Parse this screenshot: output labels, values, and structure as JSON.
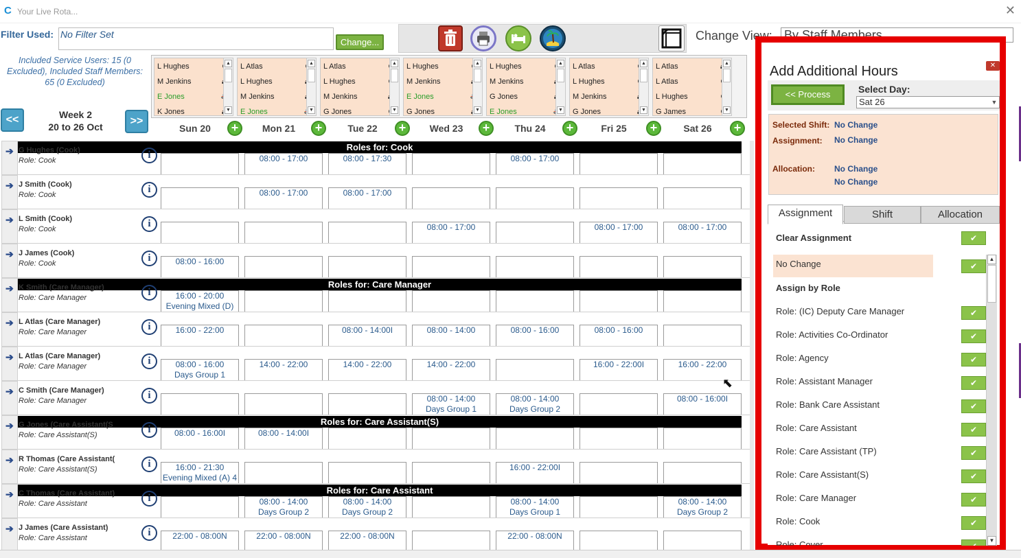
{
  "window": {
    "title": "Your Live Rota..."
  },
  "filter": {
    "label": "Filter Used:",
    "value": "No Filter Set",
    "change_label": "Change..."
  },
  "toolbar": {
    "icons": [
      "delete-icon",
      "print-icon",
      "bed-icon",
      "beach-icon",
      "expand-icon"
    ],
    "colors": {
      "delete": "#c0392b",
      "print": "#7b76c7",
      "bed": "#8bc34a",
      "beach": "#1b4f72"
    }
  },
  "change_view": {
    "label": "Change View:",
    "value": "By Staff Members"
  },
  "included": {
    "text": "Included Service Users: 15 (0 Excluded), Included Staff Members: 65 (0 Excluded)"
  },
  "week": {
    "prev": "<<",
    "next": ">>",
    "title": "Week 2",
    "range": "20 to 26 Oct"
  },
  "service_users": [
    {
      "rows": [
        {
          "name": "L Hughes",
          "icon": "no-entry-icon"
        },
        {
          "name": "M Jenkins",
          "icon": "home-out-icon"
        },
        {
          "name": "E Jones",
          "green": true,
          "icon": "ambulance-icon"
        },
        {
          "name": "K Jones",
          "icon": "home-out-icon"
        }
      ]
    },
    {
      "rows": [
        {
          "name": "L Atlas",
          "icon": "no-entry-icon"
        },
        {
          "name": "L Hughes",
          "icon": "home-out-icon"
        },
        {
          "name": "M Jenkins",
          "icon": "home-out-icon"
        },
        {
          "name": "E Jones",
          "green": true,
          "icon": "ambulance-icon"
        }
      ]
    },
    {
      "rows": [
        {
          "name": "L Atlas",
          "icon": "no-entry-icon"
        },
        {
          "name": "L Hughes",
          "icon": "no-entry-icon"
        },
        {
          "name": "M Jenkins",
          "icon": "home-out-icon"
        },
        {
          "name": "G Jones",
          "icon": "no-entry-icon"
        }
      ]
    },
    {
      "rows": [
        {
          "name": "L Hughes",
          "icon": "no-entry-icon"
        },
        {
          "name": "M Jenkins",
          "icon": "home-out-icon"
        },
        {
          "name": "E Jones",
          "green": true,
          "icon": "ambulance-icon"
        },
        {
          "name": "G Jones",
          "icon": "home-out-icon"
        }
      ]
    },
    {
      "rows": [
        {
          "name": "L Hughes",
          "icon": "no-entry-icon"
        },
        {
          "name": "M Jenkins",
          "icon": "home-out-icon"
        },
        {
          "name": "G Jones",
          "icon": "home-out-icon"
        },
        {
          "name": "E Jones",
          "green": true,
          "icon": "ambulance-icon"
        }
      ]
    },
    {
      "rows": [
        {
          "name": "L Atlas",
          "icon": "no-entry-icon"
        },
        {
          "name": "L Hughes",
          "icon": "no-entry-icon"
        },
        {
          "name": "M Jenkins",
          "icon": "home-out-icon"
        },
        {
          "name": "G Jones",
          "icon": "home-out-icon"
        }
      ]
    },
    {
      "rows": [
        {
          "name": "L Atlas",
          "icon": "home-out-icon"
        },
        {
          "name": "L Atlas",
          "icon": "no-entry-icon"
        },
        {
          "name": "L Hughes",
          "icon": "no-entry-icon"
        },
        {
          "name": "G James",
          "icon": "no-entry-icon"
        }
      ]
    }
  ],
  "days": [
    {
      "label": "Sun 20"
    },
    {
      "label": "Mon 21"
    },
    {
      "label": "Tue 22"
    },
    {
      "label": "Wed 23"
    },
    {
      "label": "Thu 24"
    },
    {
      "label": "Fri 25"
    },
    {
      "label": "Sat 26"
    }
  ],
  "rota": [
    {
      "type": "role",
      "label": "Roles for: Cook"
    },
    {
      "type": "staff",
      "name": "G Hughes (Cook)",
      "role": "Role: Cook",
      "shifts": [
        [
          "",
          ""
        ],
        [
          "08:00 - 17:00",
          ""
        ],
        [
          "08:00 - 17:30",
          ""
        ],
        [
          "",
          ""
        ],
        [
          "08:00 - 17:00",
          ""
        ],
        [
          "",
          ""
        ],
        [
          "",
          ""
        ]
      ]
    },
    {
      "type": "staff",
      "name": "J Smith (Cook)",
      "role": "Role: Cook",
      "shifts": [
        [
          "",
          ""
        ],
        [
          "08:00 - 17:00",
          ""
        ],
        [
          "08:00 - 17:00",
          ""
        ],
        [
          "",
          ""
        ],
        [
          "",
          ""
        ],
        [
          "",
          ""
        ],
        [
          "",
          ""
        ]
      ]
    },
    {
      "type": "staff",
      "name": "L Smith (Cook)",
      "role": "Role: Cook",
      "shifts": [
        [
          "",
          ""
        ],
        [
          "",
          ""
        ],
        [
          "",
          ""
        ],
        [
          "08:00 - 17:00",
          ""
        ],
        [
          "",
          ""
        ],
        [
          "08:00 - 17:00",
          ""
        ],
        [
          "08:00 - 17:00",
          ""
        ]
      ]
    },
    {
      "type": "staff",
      "name": "J James (Cook)",
      "role": "Role: Cook",
      "shifts": [
        [
          "08:00 - 16:00",
          ""
        ],
        [
          "",
          ""
        ],
        [
          "",
          ""
        ],
        [
          "",
          ""
        ],
        [
          "",
          ""
        ],
        [
          "",
          ""
        ],
        [
          "",
          ""
        ]
      ]
    },
    {
      "type": "role",
      "label": "Roles for: Care Manager"
    },
    {
      "type": "staff",
      "name": "K Smith (Care Manager)",
      "role": "Role: Care Manager",
      "shifts": [
        [
          "16:00 - 20:00",
          "Evening Mixed (D)"
        ],
        [
          "",
          ""
        ],
        [
          "",
          ""
        ],
        [
          "",
          ""
        ],
        [
          "",
          ""
        ],
        [
          "",
          ""
        ],
        [
          "",
          ""
        ]
      ]
    },
    {
      "type": "staff",
      "name": "L Atlas (Care Manager)",
      "role": "Role: Care Manager",
      "shifts": [
        [
          "16:00 - 22:00",
          ""
        ],
        [
          "",
          ""
        ],
        [
          "08:00 - 14:00I",
          ""
        ],
        [
          "08:00 - 14:00",
          ""
        ],
        [
          "08:00 - 16:00",
          ""
        ],
        [
          "08:00 - 16:00",
          ""
        ],
        [
          "",
          ""
        ]
      ]
    },
    {
      "type": "staff",
      "name": "L Atlas (Care Manager)",
      "role": "Role: Care Manager",
      "shifts": [
        [
          "08:00 - 16:00",
          "Days Group 1"
        ],
        [
          "14:00 - 22:00",
          ""
        ],
        [
          "14:00 - 22:00",
          ""
        ],
        [
          "14:00 - 22:00",
          ""
        ],
        [
          "",
          ""
        ],
        [
          "16:00 - 22:00I",
          ""
        ],
        [
          "16:00 - 22:00",
          ""
        ]
      ]
    },
    {
      "type": "staff",
      "name": "C Smith (Care Manager)",
      "role": "Role: Care Manager",
      "shifts": [
        [
          "",
          ""
        ],
        [
          "",
          ""
        ],
        [
          "",
          ""
        ],
        [
          "08:00 - 14:00",
          "Days Group 1"
        ],
        [
          "08:00 - 14:00",
          "Days Group 2"
        ],
        [
          "",
          ""
        ],
        [
          "08:00 - 16:00I",
          ""
        ]
      ]
    },
    {
      "type": "role",
      "label": "Roles for: Care Assistant(S)"
    },
    {
      "type": "staff",
      "name": "G Jones (Care Assistant(S",
      "role": "Role: Care Assistant(S)",
      "shifts": [
        [
          "08:00 - 16:00I",
          ""
        ],
        [
          "08:00 - 14:00I",
          ""
        ],
        [
          "",
          ""
        ],
        [
          "",
          ""
        ],
        [
          "",
          ""
        ],
        [
          "",
          ""
        ],
        [
          "",
          ""
        ]
      ]
    },
    {
      "type": "staff",
      "name": "R Thomas (Care Assistant(",
      "role": "Role: Care Assistant(S)",
      "shifts": [
        [
          "16:00 - 21:30",
          "Evening Mixed (A) 4"
        ],
        [
          "",
          ""
        ],
        [
          "",
          ""
        ],
        [
          "",
          ""
        ],
        [
          "16:00 - 22:00I",
          ""
        ],
        [
          "",
          ""
        ],
        [
          "",
          ""
        ]
      ]
    },
    {
      "type": "role",
      "label": "Roles for: Care Assistant"
    },
    {
      "type": "staff",
      "name": "C Thomas (Care Assistant)",
      "role": "Role: Care Assistant",
      "shifts": [
        [
          "",
          ""
        ],
        [
          "08:00 - 14:00",
          "Days Group 2"
        ],
        [
          "08:00 - 14:00",
          "Days Group 2"
        ],
        [
          "",
          ""
        ],
        [
          "08:00 - 14:00",
          "Days Group 1"
        ],
        [
          "",
          ""
        ],
        [
          "08:00 - 14:00",
          "Days Group 2"
        ]
      ]
    },
    {
      "type": "staff",
      "name": "J James (Care Assistant)",
      "role": "Role: Care Assistant",
      "shifts": [
        [
          "22:00 - 08:00N",
          ""
        ],
        [
          "22:00 - 08:00N",
          ""
        ],
        [
          "22:00 - 08:00N",
          ""
        ],
        [
          "",
          ""
        ],
        [
          "22:00 - 08:00N",
          ""
        ],
        [
          "",
          ""
        ],
        [
          "",
          ""
        ]
      ]
    }
  ],
  "panel": {
    "title": "Add Additional Hours",
    "close": "✕",
    "process_label": "<< Process",
    "select_day_label": "Select Day:",
    "select_day_value": "Sat 26",
    "selected_shift_label": "Selected Shift:",
    "selected_shift_value": "No Change",
    "assignment_label": "Assignment:",
    "assignment_value": "No Change",
    "allocation_label": "Allocation:",
    "allocation_value_1": "No Change",
    "allocation_value_2": "No Change",
    "tabs": [
      "Assignment",
      "Shift",
      "Allocation"
    ],
    "clear_assignment": "Clear Assignment",
    "options": [
      {
        "label": "No Change",
        "shaded": true,
        "check": true
      },
      {
        "label": "Assign by Role",
        "bold": true,
        "check": false
      },
      {
        "label": "Role: (IC) Deputy Care Manager",
        "check": true
      },
      {
        "label": "Role: Activities Co-Ordinator",
        "check": true
      },
      {
        "label": "Role: Agency",
        "check": true
      },
      {
        "label": "Role: Assistant Manager",
        "check": true
      },
      {
        "label": "Role: Bank Care Assistant",
        "check": true
      },
      {
        "label": "Role: Care Assistant",
        "check": true
      },
      {
        "label": "Role: Care Assistant (TP)",
        "check": true
      },
      {
        "label": "Role: Care Assistant(S)",
        "check": true
      },
      {
        "label": "Role: Care Manager",
        "check": true
      },
      {
        "label": "Role: Cook",
        "check": true
      },
      {
        "label": "Role: Cover",
        "check": true
      }
    ],
    "colors": {
      "highlight_frame": "#e60000",
      "check_green": "#8bc34a",
      "selected_bg": "#fbe3d2"
    }
  }
}
